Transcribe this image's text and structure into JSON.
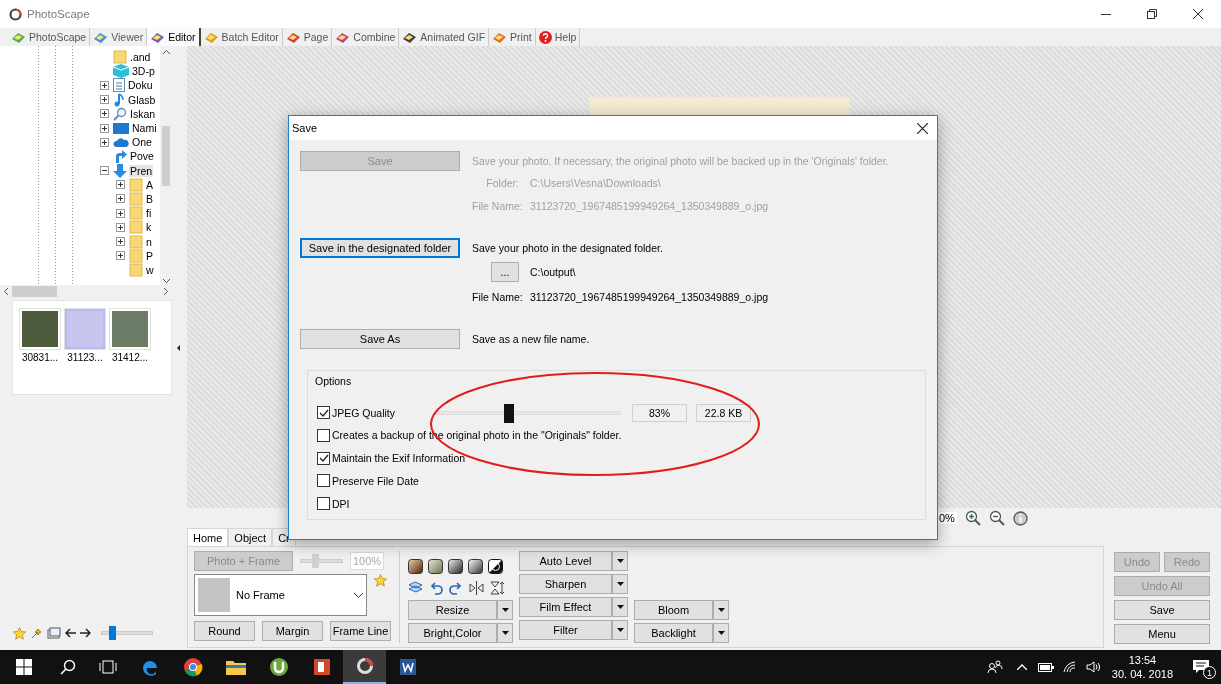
{
  "window": {
    "title": "PhotoScape"
  },
  "tabs": [
    {
      "label": "PhotoScape",
      "kind": "module",
      "selected": false
    },
    {
      "label": "Viewer",
      "kind": "module",
      "selected": false
    },
    {
      "label": "Editor",
      "kind": "module",
      "selected": true
    },
    {
      "label": "Batch Editor",
      "kind": "module",
      "selected": false
    },
    {
      "label": "Page",
      "kind": "module",
      "selected": false
    },
    {
      "label": "Combine",
      "kind": "module",
      "selected": false
    },
    {
      "label": "Animated GIF",
      "kind": "module",
      "selected": false
    },
    {
      "label": "Print",
      "kind": "module",
      "selected": false
    },
    {
      "label": "Help",
      "kind": "help",
      "selected": false
    }
  ],
  "folder_tree": {
    "items": [
      {
        "label": ".and",
        "kind": "folder",
        "selected": false
      },
      {
        "label": "3D-p",
        "kind": "cube",
        "selected": false
      },
      {
        "label": "Doku",
        "kind": "document",
        "expanded": false,
        "selected": false
      },
      {
        "label": "Glasb",
        "kind": "music",
        "expanded": false,
        "selected": false
      },
      {
        "label": "Iskan",
        "kind": "search",
        "expanded": false,
        "selected": false
      },
      {
        "label": "Nami",
        "kind": "desktop",
        "expanded": false,
        "selected": false
      },
      {
        "label": "One",
        "kind": "cloud",
        "expanded": false,
        "selected": false
      },
      {
        "label": "Pove",
        "kind": "arrow-up",
        "selected": false
      },
      {
        "label": "Pren",
        "kind": "arrow-down",
        "expanded": true,
        "selected": true,
        "children": [
          {
            "label": "A",
            "kind": "folder",
            "expanded": false,
            "selected": false
          },
          {
            "label": "B",
            "kind": "folder",
            "expanded": false,
            "selected": false
          },
          {
            "label": "fi",
            "kind": "folder",
            "expanded": false,
            "selected": false
          },
          {
            "label": "k",
            "kind": "folder",
            "expanded": false,
            "selected": false
          },
          {
            "label": "n",
            "kind": "folder",
            "expanded": false,
            "selected": false
          },
          {
            "label": "P",
            "kind": "folder",
            "expanded": false,
            "selected": false
          },
          {
            "label": "w",
            "kind": "folder",
            "selected": false
          }
        ]
      }
    ]
  },
  "thumbnails": [
    {
      "caption": "30831...",
      "selected": false
    },
    {
      "caption": "31123...",
      "selected": true
    },
    {
      "caption": "31412...",
      "selected": false
    }
  ],
  "thumbnail_size": {
    "level": 0.2
  },
  "zoom": {
    "value": "0%"
  },
  "edit_panel": {
    "tabs": [
      {
        "label": "Home",
        "selected": true
      },
      {
        "label": "Object",
        "selected": false
      },
      {
        "label": "Cr",
        "selected": false
      }
    ],
    "photo_frame": {
      "label": "Photo + Frame",
      "disabled": true
    },
    "frame_scale": {
      "level": 0.35,
      "value": "100%",
      "disabled": true
    },
    "frame_select": {
      "value": "No Frame"
    },
    "frame_buttons": [
      "Round",
      "Margin",
      "Frame Line"
    ],
    "tool_columns": [
      [
        "Resize",
        "Bright,Color"
      ],
      [
        "Auto Level",
        "Sharpen",
        "Film Effect",
        "Filter"
      ],
      [
        "Bloom",
        "Backlight"
      ]
    ]
  },
  "history_buttons": [
    {
      "label": "Undo",
      "disabled": true
    },
    {
      "label": "Redo",
      "disabled": true
    },
    {
      "label": "Undo All",
      "disabled": true
    },
    {
      "label": "Save",
      "disabled": false
    },
    {
      "label": "Menu",
      "disabled": false
    }
  ],
  "save_dialog": {
    "title": "Save",
    "actions": [
      {
        "button": "Save",
        "disabled": true,
        "focused": false,
        "description": "Save your photo. If necessary, the original photo will be backed up in the 'Originals' folder.",
        "rows": [
          {
            "label": "Folder:",
            "value": "C:\\Users\\Vesna\\Downloads\\"
          },
          {
            "label": "File Name:",
            "value": "31123720_1967485199949264_1350349889_o.jpg"
          }
        ]
      },
      {
        "button": "Save in the designated folder",
        "disabled": false,
        "focused": true,
        "description": "Save your photo in the designated folder.",
        "browse_button": "...",
        "folder": "C:\\output\\",
        "rows": [
          {
            "label": "File Name:",
            "value": "31123720_1967485199949264_1350349889_o.jpg"
          }
        ]
      },
      {
        "button": "Save As",
        "disabled": false,
        "focused": false,
        "description": "Save as a new file name."
      }
    ],
    "options": {
      "title": "Options",
      "jpeg_quality": {
        "label": "JPEG Quality",
        "checked": true,
        "level": 0.4,
        "percent": "83%",
        "size": "22.8 KB"
      },
      "checkboxes": [
        {
          "label": "Creates a backup of the original photo in the \"Originals\" folder.",
          "checked": false
        },
        {
          "label": "Maintain the Exif Information",
          "checked": true
        },
        {
          "label": "Preserve File Date",
          "checked": false
        },
        {
          "label": "DPI",
          "checked": false
        }
      ]
    }
  },
  "taskbar": {
    "apps": [
      {
        "kind": "edge",
        "active": false
      },
      {
        "kind": "chrome",
        "active": false
      },
      {
        "kind": "explorer",
        "active": false
      },
      {
        "kind": "torrent",
        "active": false
      },
      {
        "kind": "powerpoint",
        "active": false
      },
      {
        "kind": "photoscape",
        "active": true
      },
      {
        "kind": "word",
        "active": false
      }
    ],
    "time": "13:54",
    "date": "30. 04. 2018",
    "notifications": "1"
  }
}
